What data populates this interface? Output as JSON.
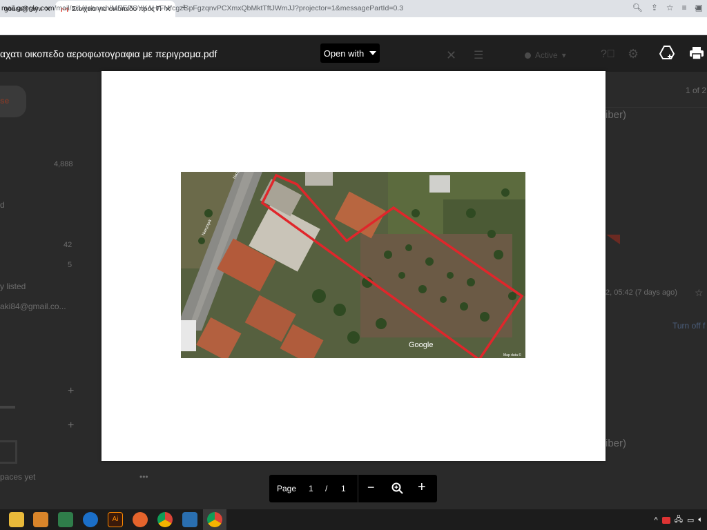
{
  "browser": {
    "tabs": [
      {
        "title": "goura@raywhi",
        "close": "✕"
      },
      {
        "title": "Στοιχεία για οικόπεδο προς Πωλ",
        "close": "✕"
      }
    ],
    "new_tab": "+",
    "tab_menu": "⌄",
    "url_host": "mail.google.com",
    "url_path": "/mail/u/1/#search/ΜΠΕΡΟΥΚΛΗ/FMfcgzGpFgzqnvPCXmxQbMktTftJWmJJ?projector=1&messagePartId=0.3"
  },
  "gmail_bg": {
    "compose": "se",
    "counts": [
      "4,888",
      "42",
      "5"
    ],
    "items": [
      "d",
      "y listed",
      "aki84@gmail.co..."
    ],
    "spaces": "paces yet",
    "pagination": "1 of 2",
    "sender_a": "iber)",
    "sender_b": "iber)",
    "date": "2, 05:42 (7 days ago)",
    "turnoff": "Turn off f",
    "status": "Active"
  },
  "viewer": {
    "title": "αχατι οικοπεδο αεροφωτογραφια με περιγραμα.pdf",
    "open_with": "Open with"
  },
  "map": {
    "watermark": "Google",
    "attribution": "Map data ©",
    "street_a": "Νικηταρά",
    "street_b": "Νικηταρά"
  },
  "pager": {
    "page_label": "Page",
    "current": "1",
    "separator": "/",
    "total": "1"
  },
  "colors": {
    "outline": "#e0262b",
    "viewer_bg": "#1f1f1f"
  }
}
